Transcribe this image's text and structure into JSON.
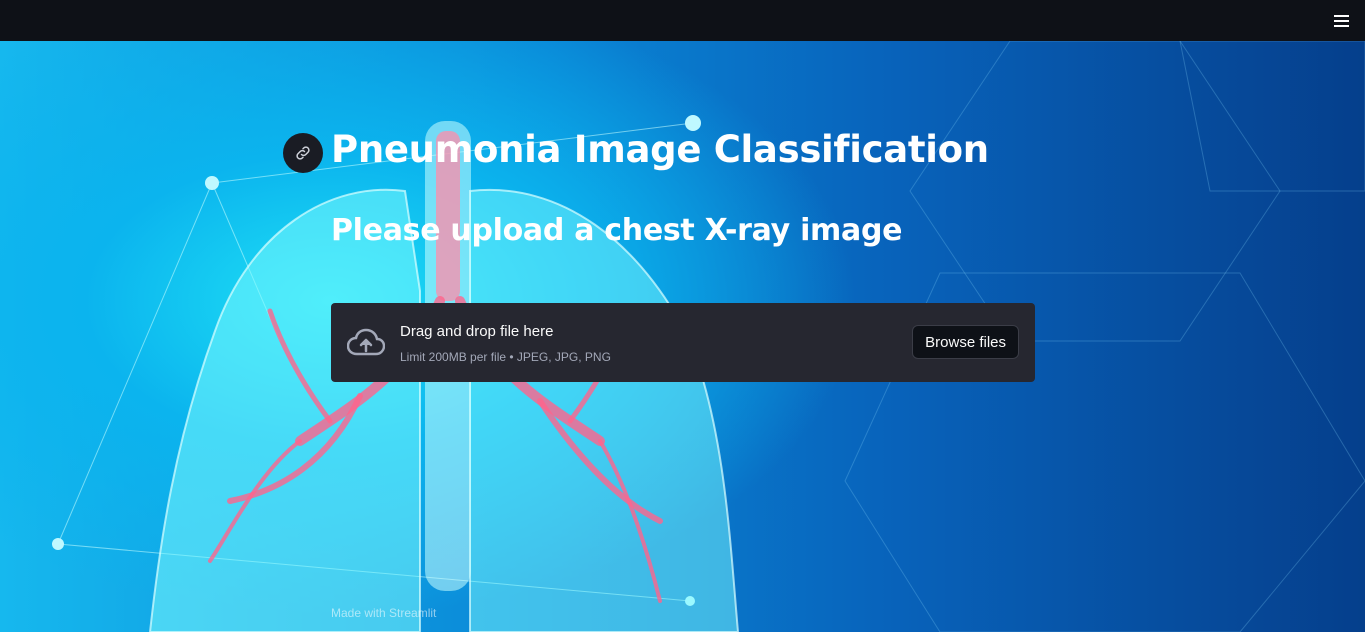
{
  "header": {
    "menu_icon": "hamburger-menu-icon"
  },
  "main": {
    "anchor_icon": "link-icon",
    "title": "Pneumonia Image Classification",
    "subtitle": "Please upload a chest X-ray image"
  },
  "uploader": {
    "icon": "cloud-upload-icon",
    "instruction": "Drag and drop file here",
    "limits": "Limit 200MB per file • JPEG, JPG, PNG",
    "button_label": "Browse files"
  },
  "footer": {
    "text": "Made with Streamlit"
  },
  "colors": {
    "topbar": "#0e1117",
    "uploader_bg": "#262730",
    "text": "#ffffff",
    "background_accent": "#1fe0f5"
  }
}
